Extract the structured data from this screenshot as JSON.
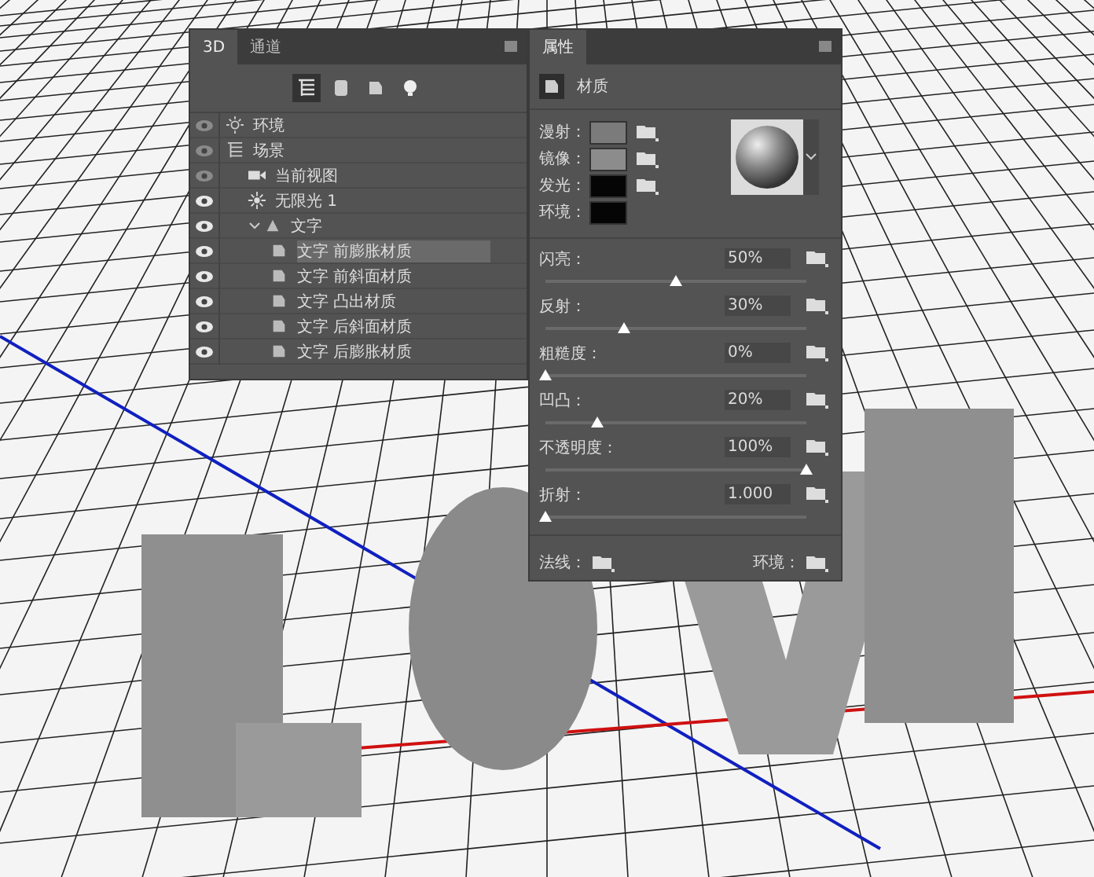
{
  "panel_3d": {
    "tabs": [
      {
        "label": "3D",
        "selected": true
      },
      {
        "label": "通道",
        "selected": false
      }
    ],
    "filters": [
      {
        "kind": "scene",
        "selected": true
      },
      {
        "kind": "mesh",
        "selected": false
      },
      {
        "kind": "material",
        "selected": false
      },
      {
        "kind": "light",
        "selected": false
      }
    ],
    "layers": [
      {
        "kind": "environment",
        "label": "环境",
        "dimmed": true,
        "selected": false
      },
      {
        "kind": "scene",
        "label": "场景",
        "dimmed": true,
        "selected": false,
        "children": [
          {
            "kind": "camera",
            "label": "当前视图",
            "dimmed": true,
            "selected": false
          },
          {
            "kind": "light",
            "label": "无限光 1",
            "dimmed": false,
            "selected": false
          },
          {
            "kind": "mesh",
            "label": "文字",
            "dimmed": false,
            "selected": false,
            "expanded": true,
            "children": [
              {
                "kind": "material",
                "label": "文字 前膨胀材质",
                "dimmed": false,
                "selected": true
              },
              {
                "kind": "material",
                "label": "文字 前斜面材质",
                "dimmed": false,
                "selected": false
              },
              {
                "kind": "material",
                "label": "文字 凸出材质",
                "dimmed": false,
                "selected": false
              },
              {
                "kind": "material",
                "label": "文字 后斜面材质",
                "dimmed": false,
                "selected": false
              },
              {
                "kind": "material",
                "label": "文字 后膨胀材质",
                "dimmed": false,
                "selected": false
              }
            ]
          }
        ]
      }
    ]
  },
  "properties": {
    "tab": "属性",
    "section": "材质",
    "swatches": [
      {
        "label": "漫射：",
        "color": "#7b7b7b",
        "texture_button": true
      },
      {
        "label": "镜像：",
        "color": "#8c8c8c",
        "texture_button": true
      },
      {
        "label": "发光：",
        "color": "#050505",
        "texture_button": true
      },
      {
        "label": "环境：",
        "color": "#050505",
        "texture_button": false
      }
    ],
    "sliders": [
      {
        "label": "闪亮：",
        "value": "50%",
        "level": 0.5
      },
      {
        "label": "反射：",
        "value": "30%",
        "level": 0.3
      },
      {
        "label": "粗糙度：",
        "value": "0%",
        "level": 0
      },
      {
        "label": "凹凸：",
        "value": "20%",
        "level": 0.2
      },
      {
        "label": "不透明度：",
        "value": "100%",
        "level": 1
      },
      {
        "label": "折射：",
        "value": "1.000",
        "level": 0
      }
    ],
    "footer": [
      {
        "label": "法线："
      },
      {
        "label": "环境："
      }
    ]
  }
}
